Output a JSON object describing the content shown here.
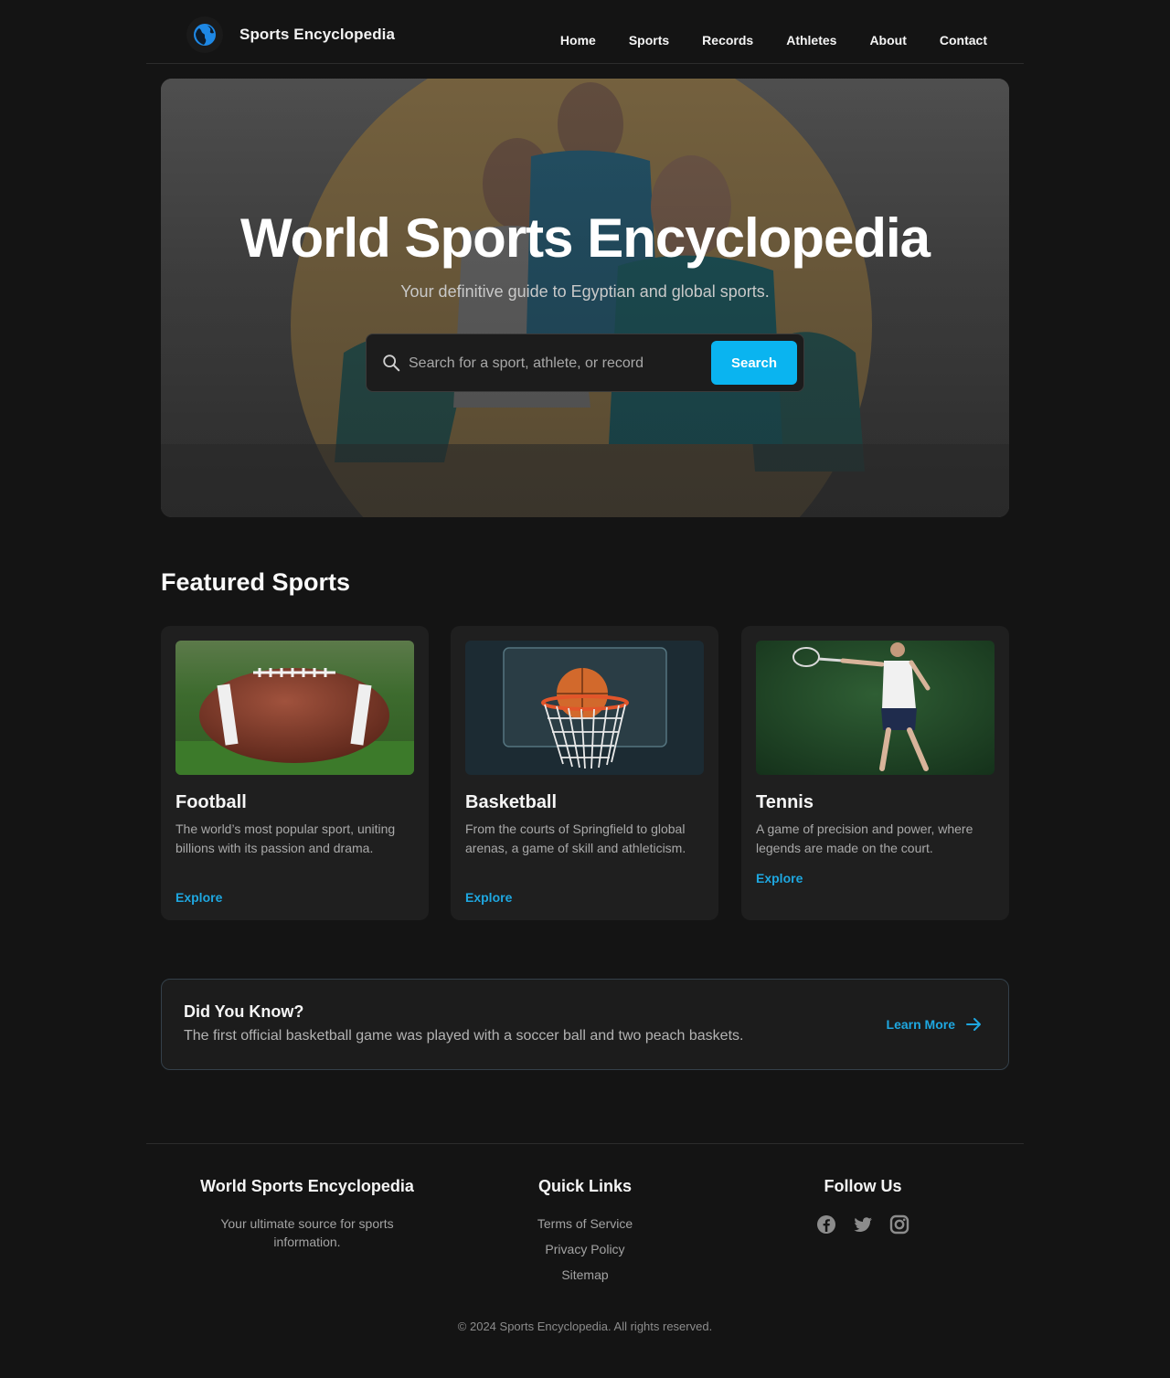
{
  "header": {
    "brand": "Sports Encyclopedia",
    "logo_icon": "globe-icon",
    "nav": [
      "Home",
      "Sports",
      "Records",
      "Athletes",
      "About",
      "Contact"
    ]
  },
  "hero": {
    "title": "World Sports Encyclopedia",
    "subtitle": "Your definitive guide to Egyptian and global sports.",
    "search": {
      "placeholder": "Search for a sport, athlete, or record",
      "button": "Search",
      "icon": "search-icon"
    }
  },
  "featured": {
    "title": "Featured Sports",
    "cards": [
      {
        "title": "Football",
        "description": "The world’s most popular sport, uniting billions with its passion and drama.",
        "link": "Explore",
        "image": "american-football-on-grass"
      },
      {
        "title": "Basketball",
        "description": "From the courts of Springfield to global arenas, a game of skill and athleticism.",
        "link": "Explore",
        "image": "basketball-hoop"
      },
      {
        "title": "Tennis",
        "description": "A game of precision and power, where legends are made on the court.",
        "link": "Explore",
        "image": "tennis-player"
      }
    ]
  },
  "did_you_know": {
    "title": "Did You Know?",
    "text": "The first official basketball game was played with a soccer ball and two peach baskets.",
    "link": "Learn More",
    "link_icon": "arrow-right-icon"
  },
  "footer": {
    "about": {
      "title": "World Sports Encyclopedia",
      "text": "Your ultimate source for sports information."
    },
    "quick_links": {
      "title": "Quick Links",
      "links": [
        "Terms of Service",
        "Privacy Policy",
        "Sitemap"
      ]
    },
    "follow": {
      "title": "Follow Us",
      "icons": [
        "facebook-icon",
        "twitter-icon",
        "instagram-icon"
      ]
    },
    "copyright": "© 2024 Sports Encyclopedia. All rights reserved."
  },
  "colors": {
    "background": "#141414",
    "accent": "#0ab4f0",
    "link": "#1ea7e0",
    "card": "#1f1f1f"
  }
}
